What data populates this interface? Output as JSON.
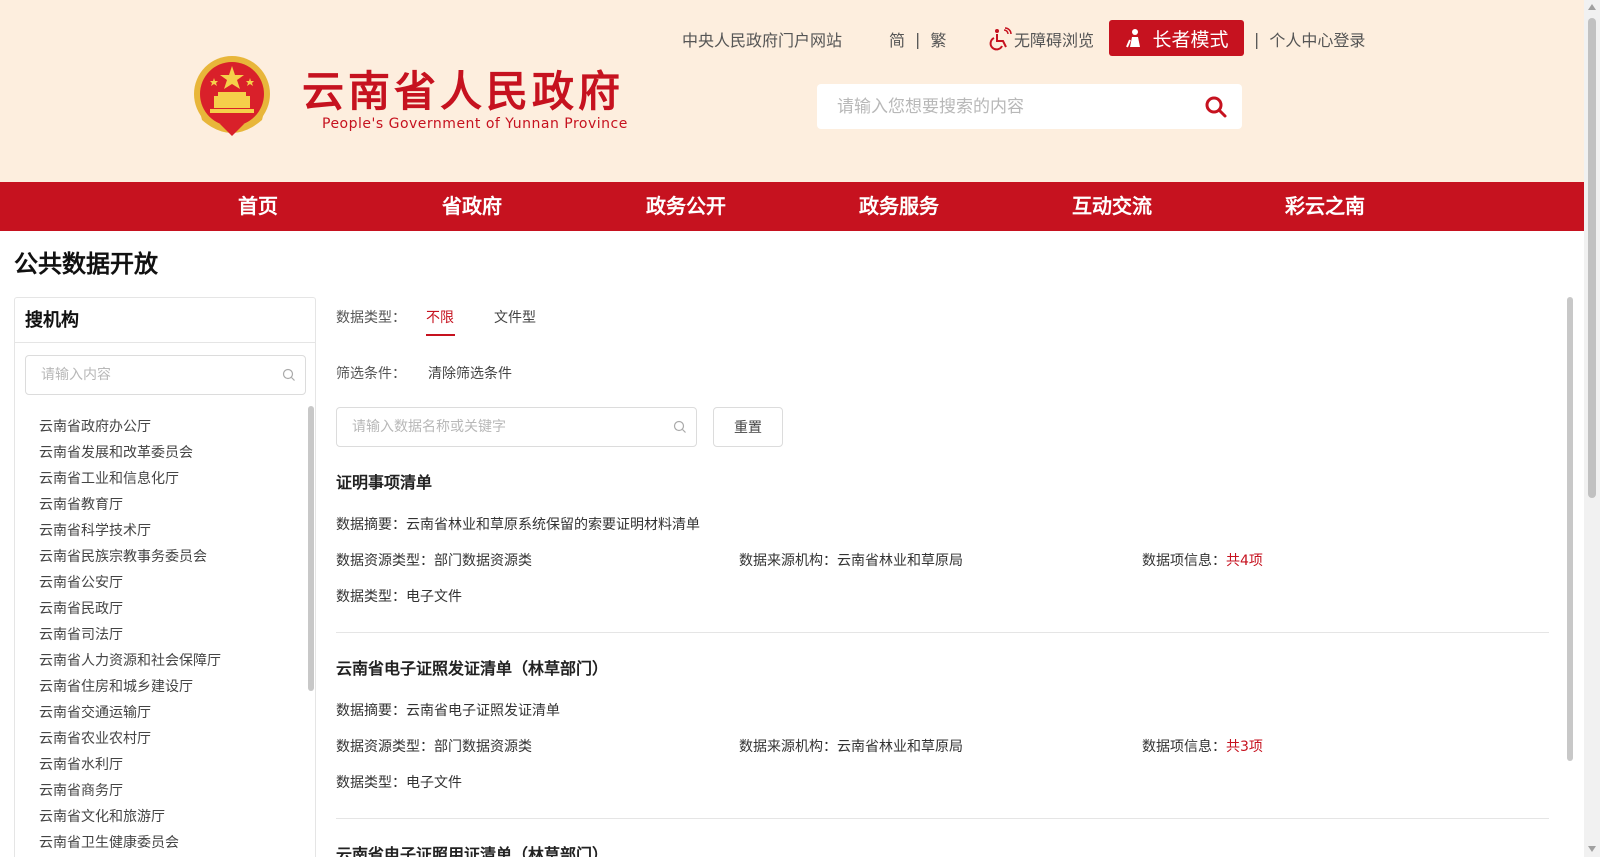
{
  "header": {
    "site_title": "云南省人民政府",
    "site_subtitle": "People's Government of Yunnan Province",
    "links": {
      "central_portal": "中央人民政府门户网站",
      "simplified": "简",
      "traditional": "繁",
      "separator": "|",
      "accessibility": "无障碍浏览",
      "elder_mode": "长者模式",
      "login": "个人中心登录"
    },
    "search": {
      "placeholder": "请输入您想要搜索的内容"
    }
  },
  "nav": {
    "items": [
      {
        "label": "首页"
      },
      {
        "label": "省政府"
      },
      {
        "label": "政务公开"
      },
      {
        "label": "政务服务"
      },
      {
        "label": "互动交流"
      },
      {
        "label": "彩云之南"
      }
    ]
  },
  "page": {
    "title": "公共数据开放"
  },
  "sidebar": {
    "title": "搜机构",
    "search_placeholder": "请输入内容",
    "items": [
      {
        "label": "云南省政府办公厅"
      },
      {
        "label": "云南省发展和改革委员会"
      },
      {
        "label": "云南省工业和信息化厅"
      },
      {
        "label": "云南省教育厅"
      },
      {
        "label": "云南省科学技术厅"
      },
      {
        "label": "云南省民族宗教事务委员会"
      },
      {
        "label": "云南省公安厅"
      },
      {
        "label": "云南省民政厅"
      },
      {
        "label": "云南省司法厅"
      },
      {
        "label": "云南省人力资源和社会保障厅"
      },
      {
        "label": "云南省住房和城乡建设厅"
      },
      {
        "label": "云南省交通运输厅"
      },
      {
        "label": "云南省农业农村厅"
      },
      {
        "label": "云南省水利厅"
      },
      {
        "label": "云南省商务厅"
      },
      {
        "label": "云南省文化和旅游厅"
      },
      {
        "label": "云南省卫生健康委员会"
      }
    ]
  },
  "filters": {
    "data_type_label": "数据类型：",
    "tabs": [
      {
        "label": "不限",
        "active": true
      },
      {
        "label": "文件型",
        "active": false
      }
    ],
    "conditions_label": "筛选条件：",
    "clear_label": "清除筛选条件",
    "search_placeholder": "请输入数据名称或关键字",
    "reset_label": "重置"
  },
  "records": [
    {
      "title": "证明事项清单",
      "summary": "数据摘要：云南省林业和草原系统保留的索要证明材料清单",
      "resource_type": "数据资源类型：部门数据资源类",
      "source_org": "数据来源机构：云南省林业和草原局",
      "items_label": "数据项信息：",
      "items_count": "共4项",
      "data_type": "数据类型：电子文件"
    },
    {
      "title": "云南省电子证照发证清单（林草部门）",
      "summary": "数据摘要：云南省电子证照发证清单",
      "resource_type": "数据资源类型：部门数据资源类",
      "source_org": "数据来源机构：云南省林业和草原局",
      "items_label": "数据项信息：",
      "items_count": "共3项",
      "data_type": "数据类型：电子文件"
    },
    {
      "title": "云南省电子证照用证清单（林草部门）"
    }
  ],
  "colors": {
    "brand_red": "#c6121f",
    "header_bg": "#fdeede"
  }
}
